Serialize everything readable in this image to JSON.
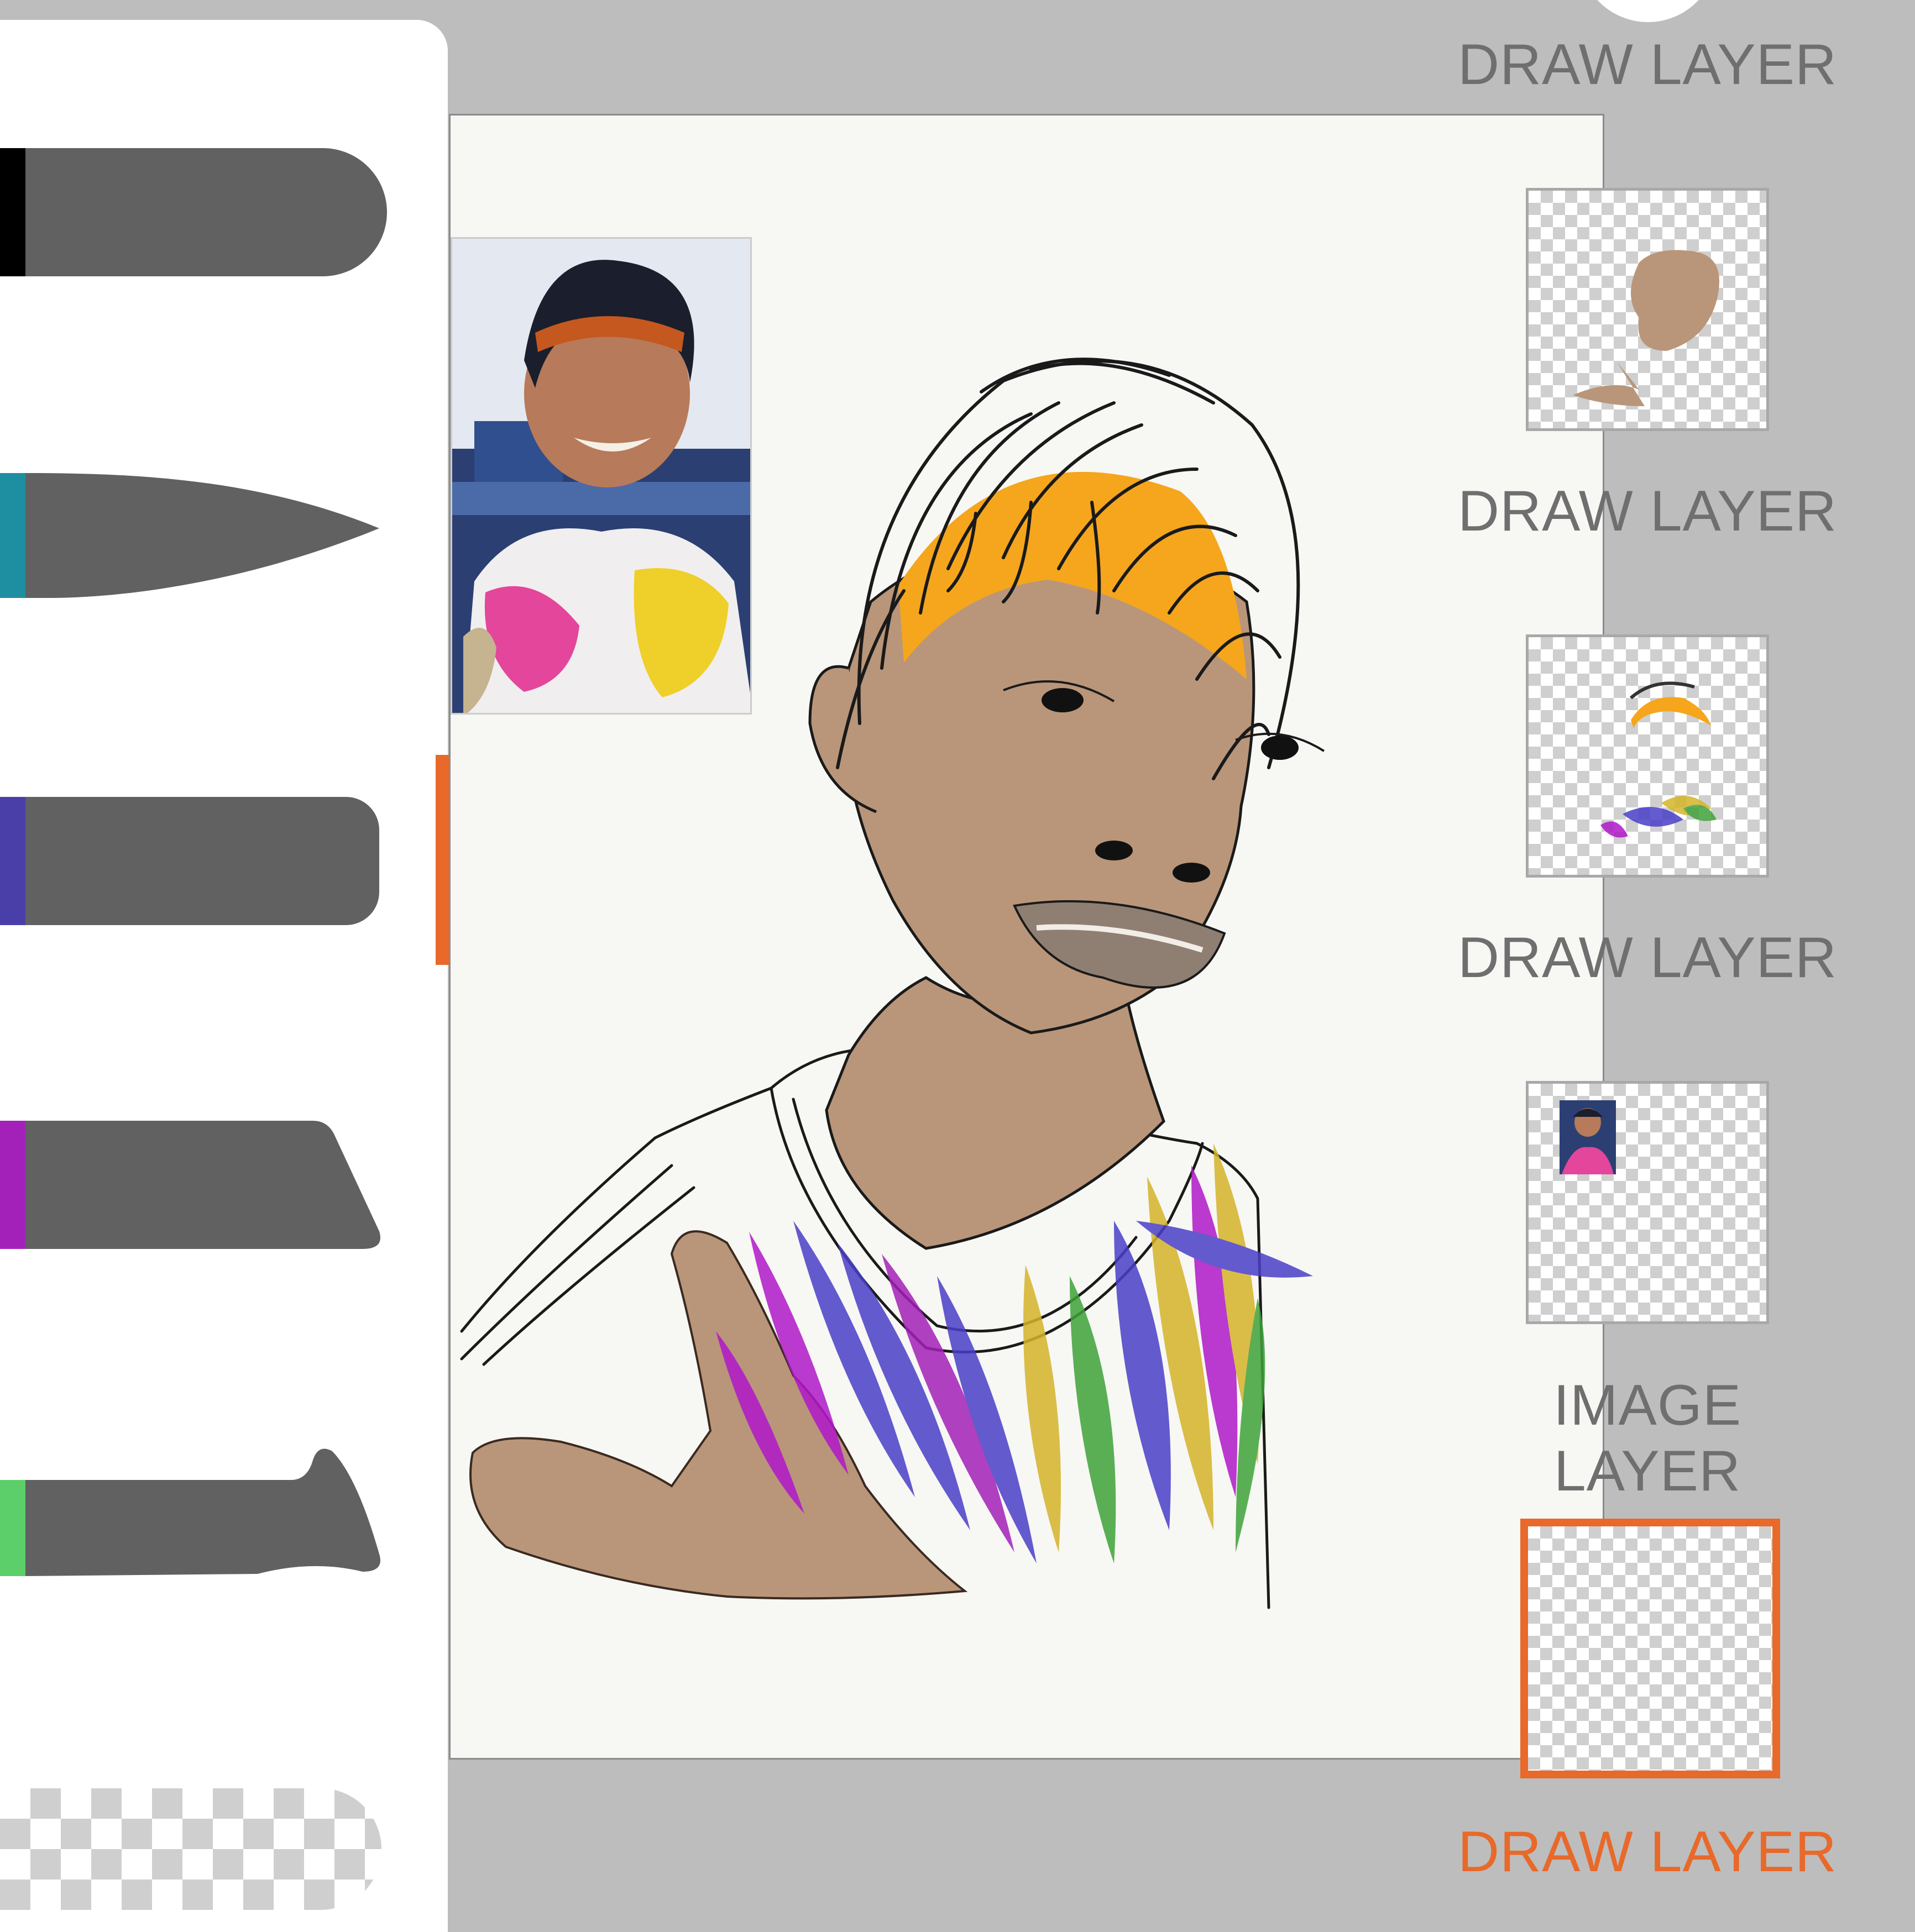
{
  "layers": [
    {
      "label": "DRAW LAYER",
      "content": "none",
      "active": false
    },
    {
      "label": "DRAW LAYER",
      "content": "skin-fill",
      "active": false
    },
    {
      "label": "DRAW LAYER",
      "content": "hair-and-shirt-color",
      "active": false
    },
    {
      "label": "IMAGE LAYER",
      "content": "reference-photo",
      "active": false
    },
    {
      "label": "DRAW LAYER",
      "content": "empty",
      "active": true
    }
  ],
  "brushes": [
    {
      "name": "round-brush",
      "swatch_color": "#000000",
      "shape": "rounded"
    },
    {
      "name": "pointed-brush",
      "swatch_color": "#1e8fa0",
      "shape": "pointed"
    },
    {
      "name": "round-brush-2",
      "swatch_color": "#4a3fa8",
      "shape": "rounded",
      "active": true
    },
    {
      "name": "chisel-brush",
      "swatch_color": "#a321b8",
      "shape": "chisel"
    },
    {
      "name": "flat-brush",
      "swatch_color": "#5ccf6a",
      "shape": "hooked"
    },
    {
      "name": "eraser-brush",
      "swatch_color": "transparent",
      "shape": "checker"
    }
  ],
  "colors": {
    "accent": "#e8692a",
    "skin": "#b9967a",
    "hair_band": "#f5a61c",
    "brush_body": "#616161",
    "workspace": "#bdbdbd",
    "canvas": "#f7f7f4"
  }
}
